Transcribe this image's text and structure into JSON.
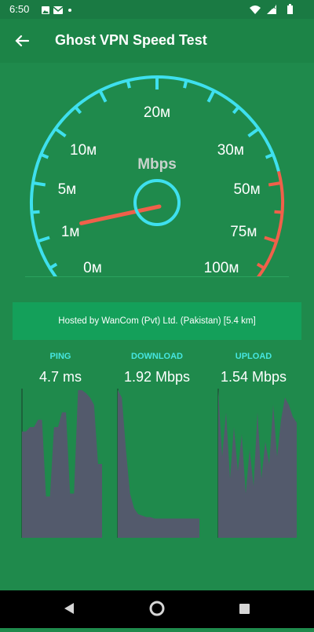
{
  "status_bar": {
    "time": "6:50"
  },
  "app_bar": {
    "title": "Ghost VPN Speed Test"
  },
  "gauge": {
    "unit": "Mbps",
    "ticks": [
      {
        "label": "0м",
        "fraction": 0.0
      },
      {
        "label": "1м",
        "fraction": 0.1
      },
      {
        "label": "5м",
        "fraction": 0.2
      },
      {
        "label": "10м",
        "fraction": 0.3
      },
      {
        "label": "20м",
        "fraction": 0.5
      },
      {
        "label": "30м",
        "fraction": 0.7
      },
      {
        "label": "50м",
        "fraction": 0.8
      },
      {
        "label": "75м",
        "fraction": 0.9
      },
      {
        "label": "100м",
        "fraction": 1.0
      }
    ],
    "needle_fraction": 0.11,
    "colors": {
      "arc": "#3ee0ee",
      "arc_high": "#f0604a",
      "needle": "#f0604a",
      "hub": "#3ee0ee"
    }
  },
  "server": {
    "hosted_text": "Hosted by WanCom (Pvt) Ltd. (Pakistan) [5.4 km]"
  },
  "metrics": {
    "ping": {
      "label": "PING",
      "value": "4.7 ms"
    },
    "download": {
      "label": "DOWNLOAD",
      "value": "1.92 Mbps"
    },
    "upload": {
      "label": "UPLOAD",
      "value": "1.54 Mbps"
    }
  },
  "graphs": {
    "color": "#535a6c",
    "ping": [
      0.72,
      0.72,
      0.75,
      0.75,
      0.8,
      0.8,
      0.28,
      0.28,
      0.75,
      0.75,
      0.85,
      0.85,
      0.3,
      0.3,
      1.0,
      1.0,
      0.98,
      0.95,
      0.9,
      0.5,
      0.5
    ],
    "download": [
      1.0,
      0.95,
      0.6,
      0.3,
      0.2,
      0.16,
      0.15,
      0.14,
      0.14,
      0.13,
      0.13,
      0.13,
      0.13,
      0.13,
      0.13,
      0.13,
      0.13,
      0.13,
      0.13,
      0.13,
      0.13
    ],
    "upload": [
      1.0,
      0.55,
      0.85,
      0.4,
      0.75,
      0.45,
      0.7,
      0.3,
      0.6,
      0.35,
      0.85,
      0.4,
      0.65,
      0.5,
      0.9,
      0.55,
      0.8,
      0.95,
      0.9,
      0.82,
      0.78
    ]
  }
}
